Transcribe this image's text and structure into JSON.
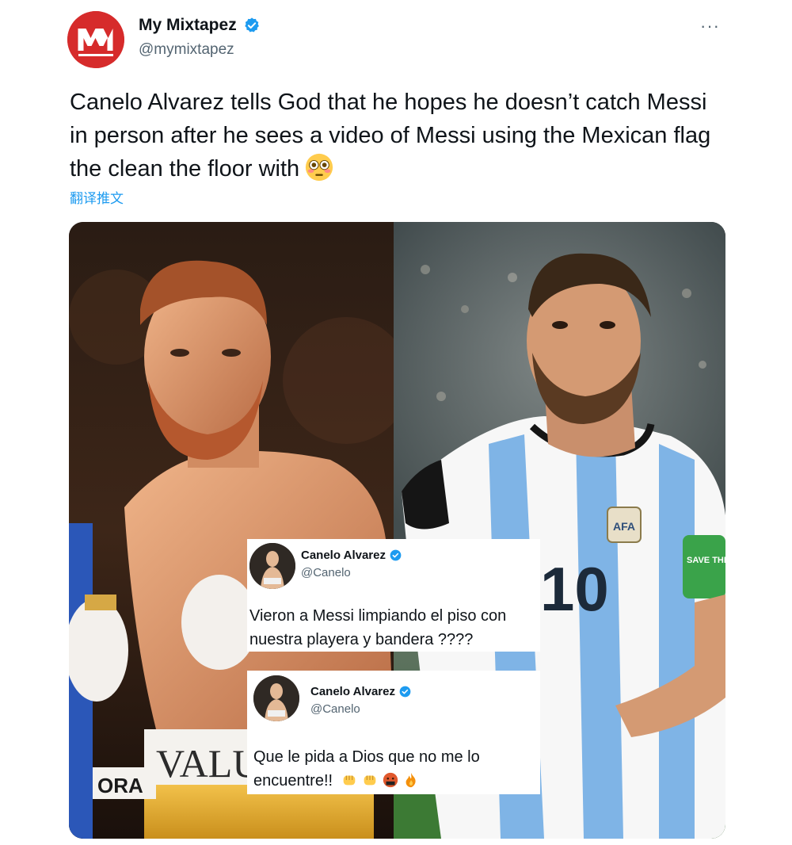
{
  "tweet": {
    "display_name": "My Mixtapez",
    "handle": "@mymixtapez",
    "avatar_text": "MM",
    "verified": true,
    "text": "Canelo Alvarez tells God that he hopes he doesn’t catch Messi in person after he sees a video of Messi using the Mexican flag the clean the floor with",
    "emoji": "flushed-face",
    "translate_label": "翻译推文",
    "more_label": "···"
  },
  "media": {
    "left_photo": "boxer",
    "right_photo": "soccer-player",
    "boxer_trunks_text": "VALUE",
    "ring_text": "ORA",
    "jersey_number": "10",
    "armband_text": "SAVE THE PLAN",
    "jersey_badge": "AFA"
  },
  "embedded_replies": [
    {
      "name": "Canelo Alvarez",
      "handle": "@Canelo",
      "verified": true,
      "text": "Vieron a Messi limpiando el piso con nuestra playera y bandera ????"
    },
    {
      "name": "Canelo Alvarez",
      "handle": "@Canelo",
      "verified": true,
      "text": "Que le pida a Dios que no me lo encuentre!!",
      "emojis": [
        "fist-icon",
        "fist-icon",
        "cursing-face-icon",
        "fire-icon"
      ]
    }
  ],
  "colors": {
    "accent": "#1d9bf0",
    "avatar_bg": "#d62b2b",
    "text": "#0f1419",
    "muted": "#536471"
  }
}
